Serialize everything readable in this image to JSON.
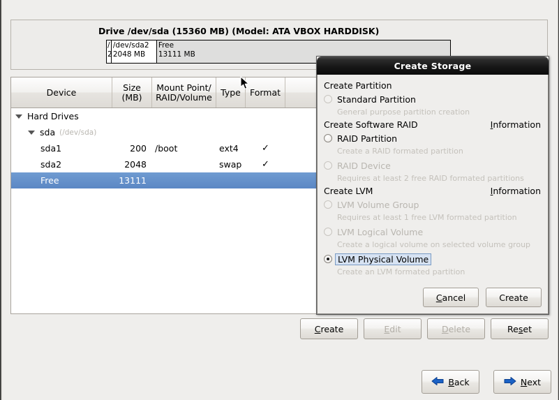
{
  "drive": {
    "title": "Drive /dev/sda (15360 MB) (Model: ATA VBOX HARDDISK)",
    "segments": [
      {
        "name": "/",
        "size": "2",
        "width_pct": 1.4,
        "style": "used"
      },
      {
        "name": "/dev/sda2",
        "size": "2048 MB",
        "width_pct": 13.2,
        "style": "used"
      },
      {
        "name": "Free",
        "size": "13111 MB",
        "width_pct": 85.4,
        "style": "free"
      }
    ]
  },
  "table": {
    "headers": [
      "Device",
      "Size\n(MB)",
      "Mount Point/\nRAID/Volume",
      "Type",
      "Format",
      ""
    ],
    "header_device": "Device",
    "header_size_l1": "Size",
    "header_size_l2": "(MB)",
    "header_mount_l1": "Mount Point/",
    "header_mount_l2": "RAID/Volume",
    "header_type": "Type",
    "header_format": "Format",
    "rows": [
      {
        "device": "Hard Drives",
        "devpath": "",
        "size": "",
        "mount": "",
        "type": "",
        "format": "",
        "indent": 0,
        "expander": true,
        "selected": false
      },
      {
        "device": "sda",
        "devpath": "(/dev/sda)",
        "size": "",
        "mount": "",
        "type": "",
        "format": "",
        "indent": 1,
        "expander": true,
        "selected": false
      },
      {
        "device": "sda1",
        "devpath": "",
        "size": "200",
        "mount": "/boot",
        "type": "ext4",
        "format": "✓",
        "indent": 2,
        "expander": false,
        "selected": false
      },
      {
        "device": "sda2",
        "devpath": "",
        "size": "2048",
        "mount": "",
        "type": "swap",
        "format": "✓",
        "indent": 2,
        "expander": false,
        "selected": false
      },
      {
        "device": "Free",
        "devpath": "",
        "size": "13111",
        "mount": "",
        "type": "",
        "format": "",
        "indent": 2,
        "expander": false,
        "selected": true
      }
    ]
  },
  "actions": {
    "create": "Create",
    "edit": "Edit",
    "delete": "Delete",
    "reset": "Reset"
  },
  "nav": {
    "back": "Back",
    "next": "Next",
    "arrow_color": "#1b62c6"
  },
  "dialog": {
    "title": "Create Storage",
    "groups": [
      {
        "heading": "Create Partition",
        "information": "",
        "options": [
          {
            "label": "Standard Partition",
            "desc": "General purpose partition creation",
            "checked": false,
            "enabled": true,
            "dim_radio": true,
            "focused": false
          }
        ]
      },
      {
        "heading": "Create Software RAID",
        "information": "Information",
        "options": [
          {
            "label": "RAID Partition",
            "desc": "Create a RAID formated partition",
            "checked": false,
            "enabled": true,
            "dim_radio": false,
            "focused": false
          },
          {
            "label": "RAID Device",
            "desc": "Requires at least 2 free RAID formated partitions",
            "checked": false,
            "enabled": false,
            "dim_radio": true,
            "focused": false
          }
        ]
      },
      {
        "heading": "Create LVM",
        "information": "Information",
        "options": [
          {
            "label": "LVM Volume Group",
            "desc": "Requires at least 1 free LVM formated partition",
            "checked": false,
            "enabled": false,
            "dim_radio": true,
            "focused": false
          },
          {
            "label": "LVM Logical Volume",
            "desc": "Create a logical volume on selected volume group",
            "checked": false,
            "enabled": false,
            "dim_radio": true,
            "focused": false
          },
          {
            "label": "LVM Physical Volume",
            "desc": "Create an LVM formated partition",
            "checked": true,
            "enabled": true,
            "dim_radio": false,
            "focused": true
          }
        ]
      }
    ],
    "cancel": "Cancel",
    "create": "Create"
  },
  "colors": {
    "selection_blue": "#5b87c4",
    "window_bg": "#efeeec",
    "focus_outline": "#7a9bc4"
  }
}
